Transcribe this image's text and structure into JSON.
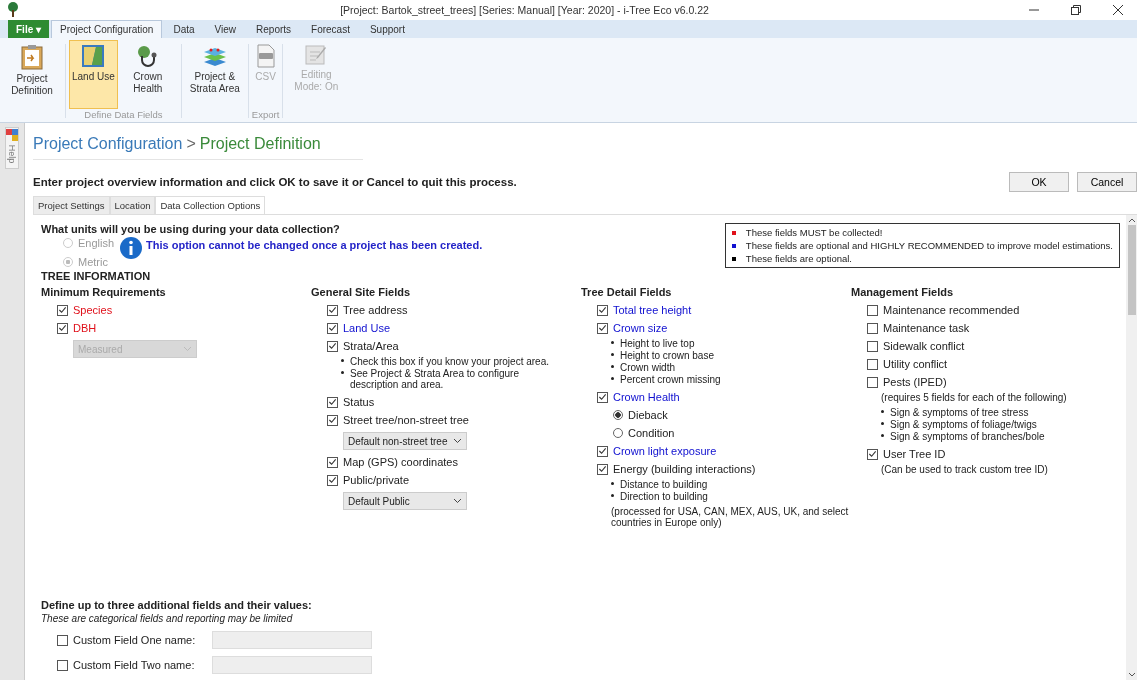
{
  "window": {
    "title": "[Project: Bartok_street_trees] [Series: Manual] [Year: 2020] - i-Tree Eco v6.0.22"
  },
  "menu_tabs": [
    {
      "label": "File ▾",
      "kind": "file",
      "selected": false
    },
    {
      "label": "Project Configuration",
      "kind": "tab",
      "selected": true
    },
    {
      "label": "Data",
      "kind": "tab",
      "selected": false
    },
    {
      "label": "View",
      "kind": "tab",
      "selected": false
    },
    {
      "label": "Reports",
      "kind": "tab",
      "selected": false
    },
    {
      "label": "Forecast",
      "kind": "tab",
      "selected": false
    },
    {
      "label": "Support",
      "kind": "tab",
      "selected": false
    }
  ],
  "ribbon_groups": [
    {
      "items": [
        {
          "label": "Project Definition",
          "selected": false,
          "disabled": false
        }
      ]
    },
    {
      "label": "Define Data Fields",
      "items": [
        {
          "label": "Land Use",
          "selected": true,
          "disabled": false
        },
        {
          "label": "Crown Health",
          "selected": false,
          "disabled": false
        }
      ]
    },
    {
      "items": [
        {
          "label": "Project & Strata Area",
          "selected": false,
          "disabled": false
        }
      ]
    },
    {
      "label": "Export",
      "items": [
        {
          "label": "CSV",
          "selected": false,
          "disabled": true
        }
      ]
    },
    {
      "items": [
        {
          "label": "Editing Mode: On",
          "selected": false,
          "disabled": true
        }
      ]
    }
  ],
  "help_tab": "Help",
  "breadcrumb": {
    "parent": "Project Configuration",
    "separator": ">",
    "current": "Project Definition"
  },
  "instruction": "Enter project overview information and click OK to save it or Cancel to quit this process.",
  "buttons": [
    "OK",
    "Cancel"
  ],
  "tabs": [
    {
      "label": "Project Settings",
      "selected": false
    },
    {
      "label": "Location",
      "selected": false
    },
    {
      "label": "Data Collection Options",
      "selected": true
    }
  ],
  "units": {
    "question": "What units will you be using during your data collection?",
    "options": [
      {
        "label": "English",
        "selected": false,
        "disabled": true
      },
      {
        "label": "Metric",
        "selected": true,
        "disabled": true
      }
    ],
    "note": "This option cannot be changed once a project has been created."
  },
  "legend": [
    {
      "color": "#e0101a",
      "text": "These fields MUST be collected!"
    },
    {
      "color": "#1010d0",
      "text": "These fields are optional and HIGHLY RECOMMENDED to improve model estimations."
    },
    {
      "color": "#000000",
      "text": "These fields are optional."
    }
  ],
  "section_title": "TREE INFORMATION",
  "columns": [
    {
      "title": "Minimum Requirements",
      "items": [
        {
          "kind": "checkbox",
          "label": "Species",
          "checked": true,
          "color": "#e0101a"
        },
        {
          "kind": "checkbox",
          "label": "DBH",
          "checked": true,
          "color": "#e0101a"
        },
        {
          "kind": "select",
          "value": "Measured",
          "disabled": true
        }
      ]
    },
    {
      "title": "General Site Fields",
      "items": [
        {
          "kind": "checkbox",
          "label": "Tree address",
          "checked": true
        },
        {
          "kind": "checkbox",
          "label": "Land Use",
          "checked": true,
          "color": "#1010d0"
        },
        {
          "kind": "checkbox",
          "label": "Strata/Area",
          "checked": true
        },
        {
          "kind": "bullets",
          "lines": [
            "Check this box if you know your project area.",
            "See Project & Strata Area to configure description and area."
          ]
        },
        {
          "kind": "checkbox",
          "label": "Status",
          "checked": true
        },
        {
          "kind": "checkbox",
          "label": "Street tree/non-street tree",
          "checked": true
        },
        {
          "kind": "select",
          "value": "Default non-street tree",
          "disabled": false
        },
        {
          "kind": "checkbox",
          "label": "Map (GPS) coordinates",
          "checked": true
        },
        {
          "kind": "checkbox",
          "label": "Public/private",
          "checked": true
        },
        {
          "kind": "select",
          "value": "Default Public",
          "disabled": false
        }
      ]
    },
    {
      "title": "Tree Detail Fields",
      "items": [
        {
          "kind": "checkbox",
          "label": "Total tree height",
          "checked": true,
          "color": "#1010d0"
        },
        {
          "kind": "checkbox",
          "label": "Crown size",
          "checked": true,
          "color": "#1010d0"
        },
        {
          "kind": "bullets",
          "lines": [
            "Height to live top",
            "Height to crown base",
            "Crown width",
            "Percent crown missing"
          ]
        },
        {
          "kind": "checkbox",
          "label": "Crown Health",
          "checked": true,
          "color": "#1010d0"
        },
        {
          "kind": "radio",
          "label": "Dieback",
          "selected": true
        },
        {
          "kind": "radio",
          "label": "Condition",
          "selected": false
        },
        {
          "kind": "checkbox",
          "label": "Crown light exposure",
          "checked": true,
          "color": "#1010d0"
        },
        {
          "kind": "checkbox",
          "label": "Energy (building interactions)",
          "checked": true
        },
        {
          "kind": "bullets",
          "lines": [
            "Distance to building",
            "Direction to building"
          ]
        },
        {
          "kind": "note",
          "text": "(processed for USA, CAN, MEX, AUS, UK, and select countries in Europe only)"
        }
      ]
    },
    {
      "title": "Management Fields",
      "items": [
        {
          "kind": "checkbox",
          "label": "Maintenance recommended",
          "checked": false
        },
        {
          "kind": "checkbox",
          "label": "Maintenance task",
          "checked": false
        },
        {
          "kind": "checkbox",
          "label": "Sidewalk conflict",
          "checked": false
        },
        {
          "kind": "checkbox",
          "label": "Utility conflict",
          "checked": false
        },
        {
          "kind": "checkbox",
          "label": "Pests (IPED)",
          "checked": false
        },
        {
          "kind": "note",
          "text": "(requires 5 fields for each of the following)"
        },
        {
          "kind": "bullets",
          "lines": [
            "Sign & symptoms of tree stress",
            "Sign & symptoms of foliage/twigs",
            "Sign & symptoms of branches/bole"
          ]
        },
        {
          "kind": "checkbox",
          "label": "User Tree ID",
          "checked": true
        },
        {
          "kind": "note",
          "text": "(Can be used to track custom tree ID)"
        }
      ]
    }
  ],
  "custom_fields": {
    "title": "Define up to three additional fields and their values:",
    "subtitle": "These are categorical fields and reporting may be limited",
    "rows": [
      {
        "label": "Custom Field One name:",
        "checked": false
      },
      {
        "label": "Custom Field Two name:",
        "checked": false
      }
    ]
  }
}
